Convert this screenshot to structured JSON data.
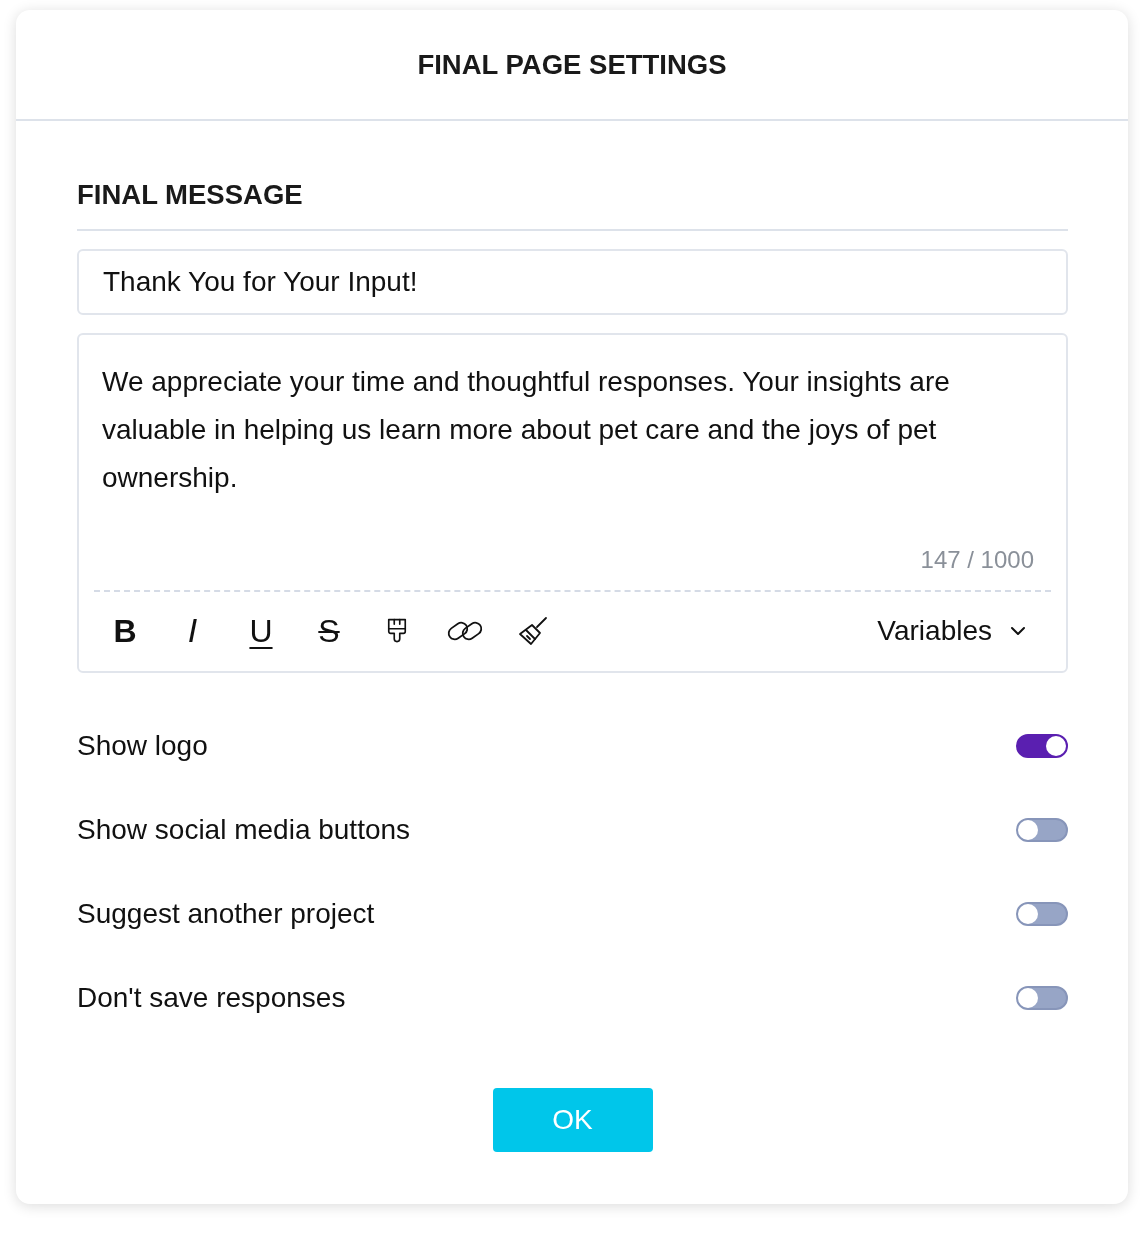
{
  "dialog": {
    "title": "FINAL PAGE SETTINGS"
  },
  "final_message": {
    "heading": "FINAL MESSAGE",
    "title_field": {
      "value": "Thank You for Your Input!"
    },
    "body_field": {
      "value": "We appreciate your time and thoughtful responses. Your insights are valuable in helping us learn more about pet care and the joys of pet ownership.",
      "counter": "147 / 1000"
    },
    "toolbar": {
      "tools": [
        {
          "kind": "bold",
          "label": "B"
        },
        {
          "kind": "italic",
          "label": "I"
        },
        {
          "kind": "underline",
          "label": "U"
        },
        {
          "kind": "strikethrough",
          "label": "S"
        },
        {
          "kind": "brush"
        },
        {
          "kind": "link"
        },
        {
          "kind": "broom"
        }
      ],
      "variables_label": "Variables"
    }
  },
  "options": [
    {
      "label": "Show logo",
      "on": true
    },
    {
      "label": "Show social media buttons",
      "on": false
    },
    {
      "label": "Suggest another project",
      "on": false
    },
    {
      "label": "Don't save responses",
      "on": false
    }
  ],
  "ok_button": "OK"
}
